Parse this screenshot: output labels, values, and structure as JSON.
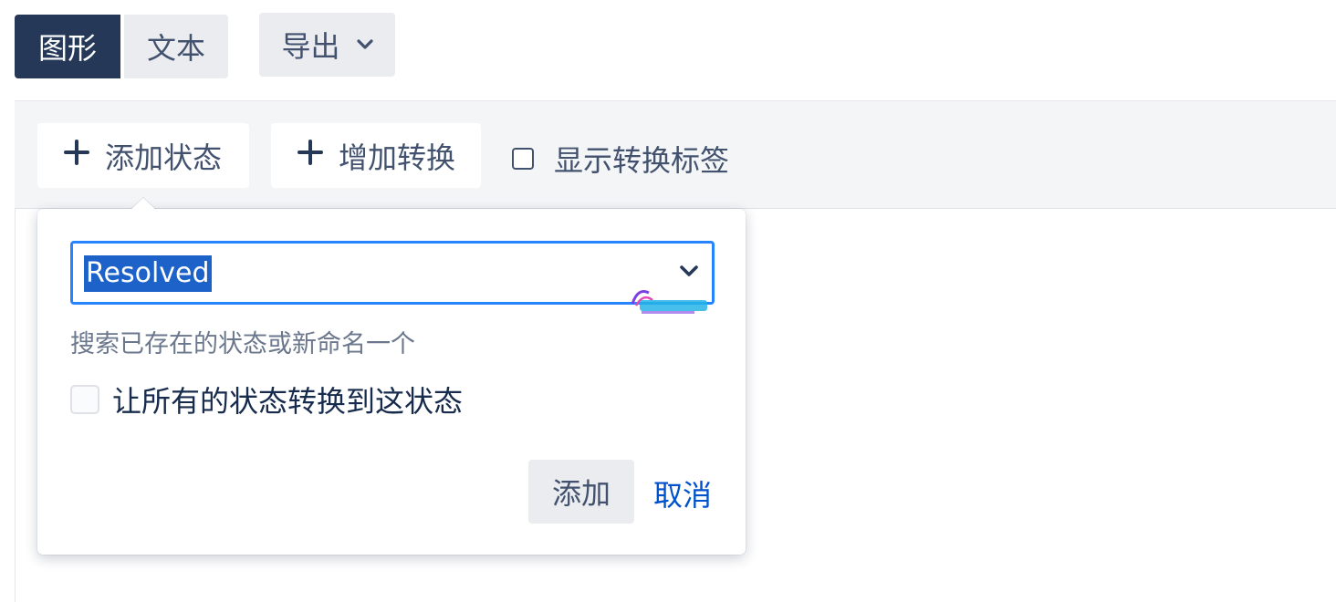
{
  "view_tabs": {
    "diagram_label": "图形",
    "text_label": "文本"
  },
  "export": {
    "label": "导出",
    "icon": "chevron-down-icon"
  },
  "toolbar": {
    "add_status_label": "添加状态",
    "add_transition_label": "增加转换",
    "show_labels_label": "显示转换标签",
    "show_labels_checked": false,
    "plus_icon": "plus-icon"
  },
  "add_status_dialog": {
    "status_value": "Resolved",
    "hint": "搜索已存在的状态或新命名一个",
    "all_transition_label": "让所有的状态转换到这状态",
    "all_transition_checked": false,
    "add_label": "添加",
    "cancel_label": "取消"
  },
  "colors": {
    "selected_tab": "#253858",
    "focus_border": "#2684ff",
    "text_selection": "#1d62c8",
    "link": "#0052cc",
    "button_bg": "#ebecf0",
    "toolbar_bg": "#f4f5f7"
  }
}
